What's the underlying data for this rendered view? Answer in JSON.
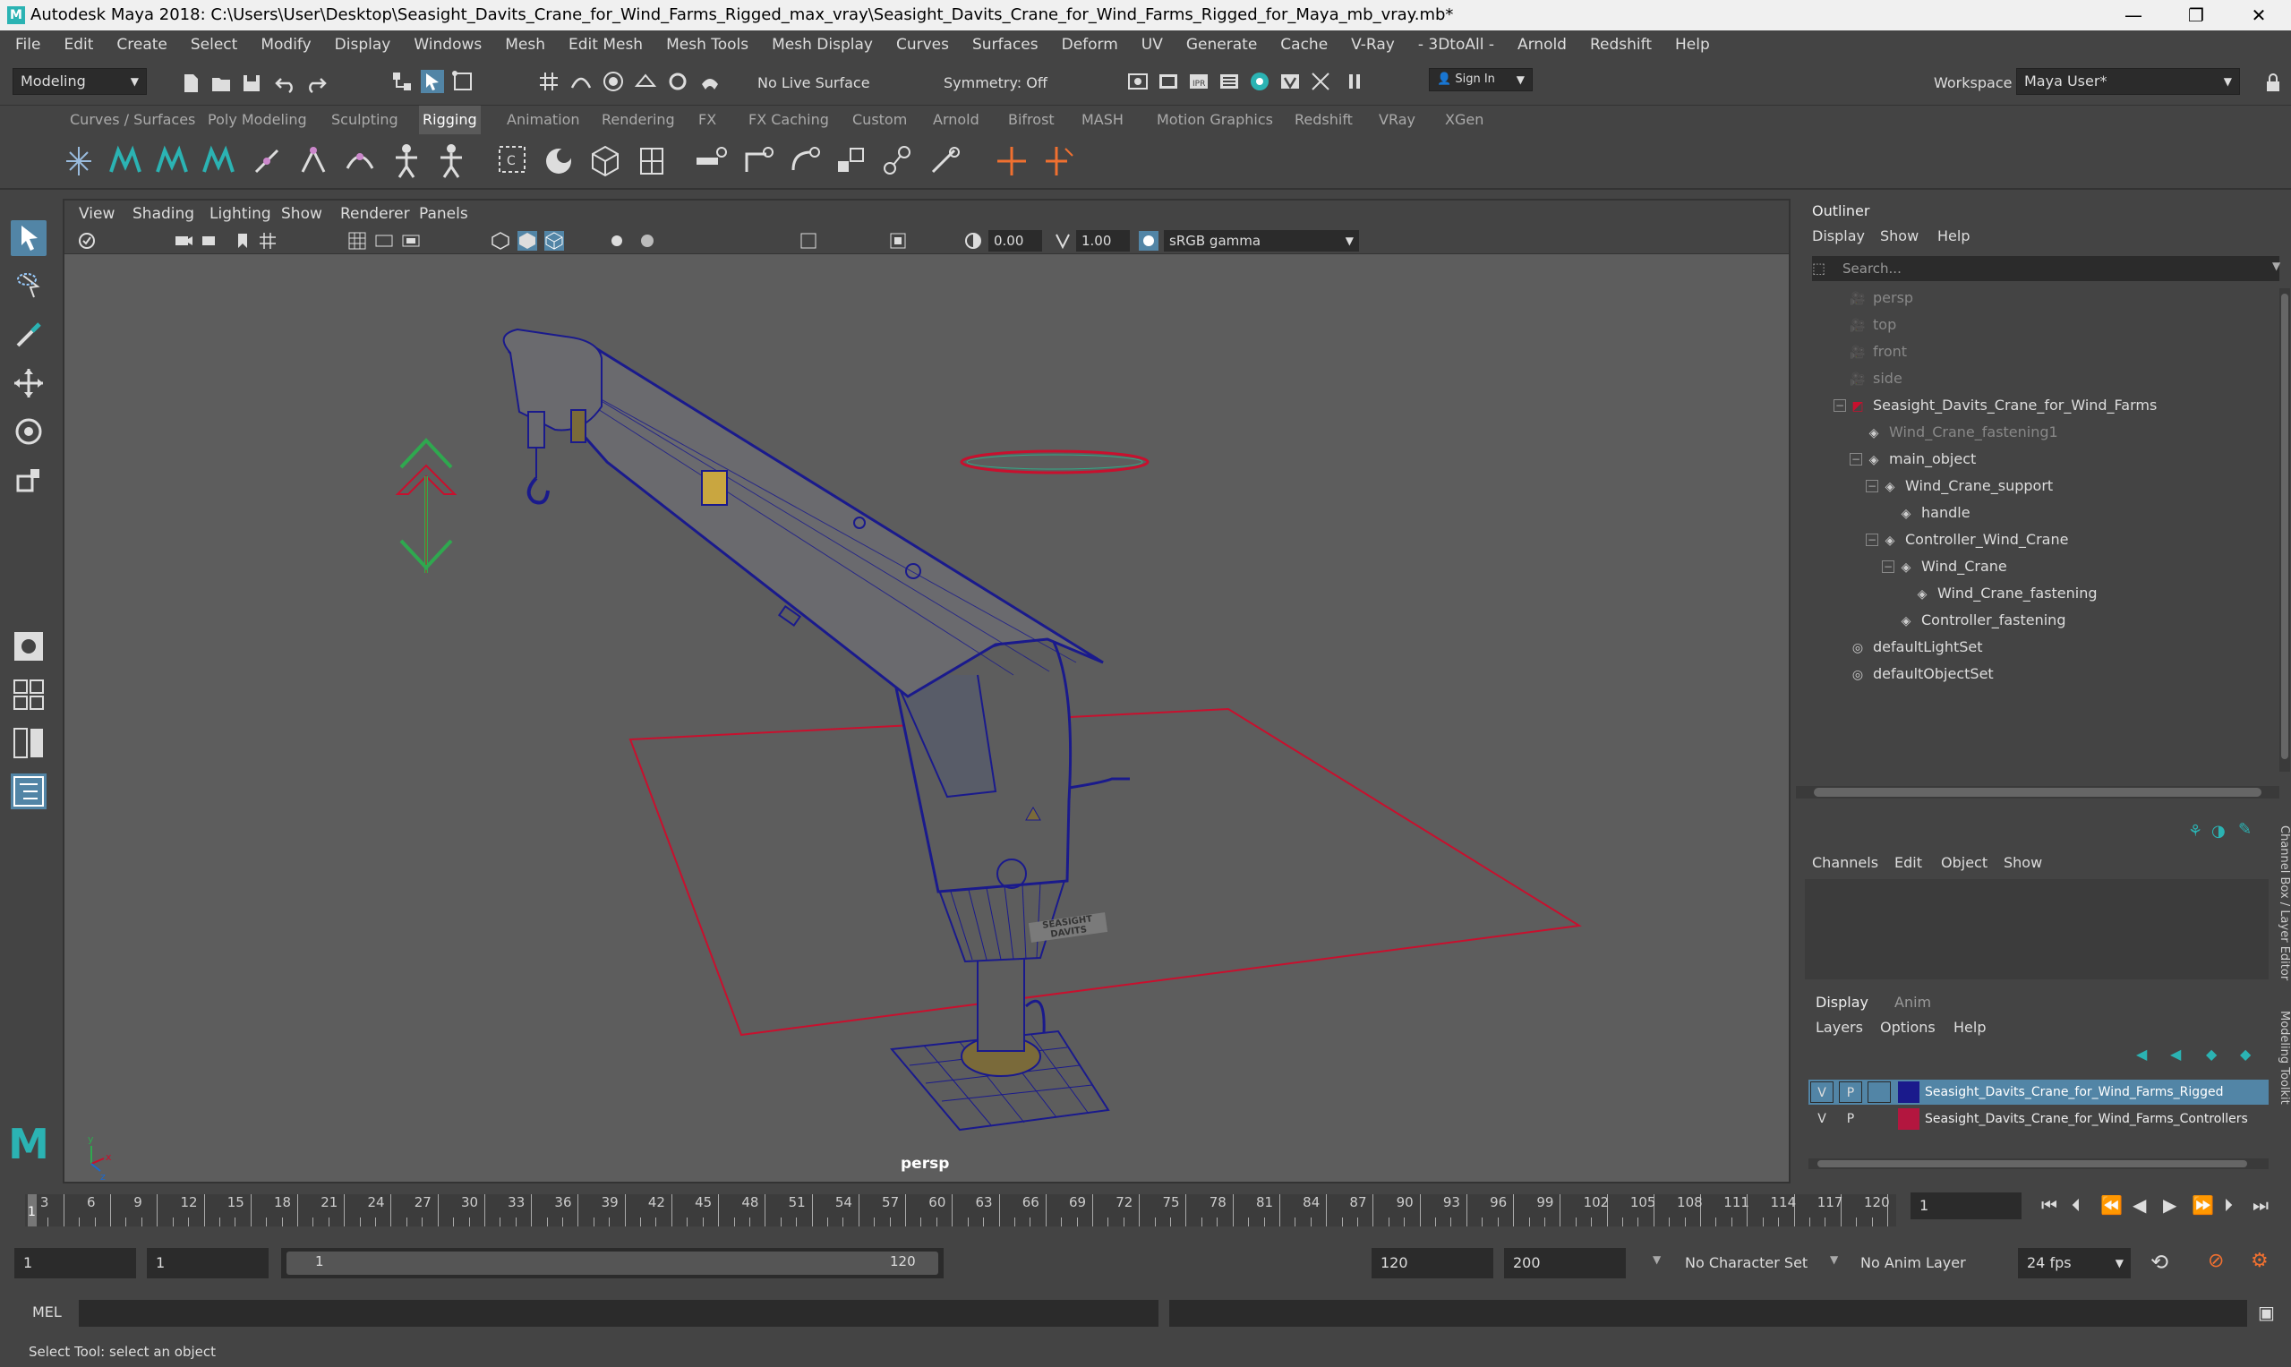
{
  "app": {
    "title": "Autodesk Maya 2018: C:\\Users\\User\\Desktop\\Seasight_Davits_Crane_for_Wind_Farms_Rigged_max_vray\\Seasight_Davits_Crane_for_Wind_Farms_Rigged_for_Maya_mb_vray.mb*",
    "logo_letter": "M"
  },
  "window_controls": {
    "minimize": "—",
    "maximize": "❐",
    "close": "✕"
  },
  "menubar": [
    "File",
    "Edit",
    "Create",
    "Select",
    "Modify",
    "Display",
    "Windows",
    "Mesh",
    "Edit Mesh",
    "Mesh Tools",
    "Mesh Display",
    "Curves",
    "Surfaces",
    "Deform",
    "UV",
    "Generate",
    "Cache",
    "V-Ray",
    "- 3DtoAll -",
    "Arnold",
    "Redshift",
    "Help"
  ],
  "status": {
    "mode": "Modeling",
    "live_surface": "No Live Surface",
    "symmetry": "Symmetry: Off",
    "sign_in": "Sign In",
    "workspace_label": "Workspace :",
    "workspace_value": "Maya User*"
  },
  "shelf_tabs": [
    "Curves / Surfaces",
    "Poly Modeling",
    "Sculpting",
    "Rigging",
    "Animation",
    "Rendering",
    "FX",
    "FX Caching",
    "Custom",
    "Arnold",
    "Bifrost",
    "MASH",
    "Motion Graphics",
    "Redshift",
    "VRay",
    "XGen"
  ],
  "shelf_active": "Rigging",
  "viewport": {
    "menu": [
      "View",
      "Shading",
      "Lighting",
      "Show",
      "Renderer",
      "Panels"
    ],
    "exposure": "0.00",
    "gamma": "1.00",
    "color_space": "sRGB gamma",
    "camera": "persp",
    "sign_text": "SEASIGHT DAVITS"
  },
  "outliner": {
    "title": "Outliner",
    "menu": [
      "Display",
      "Show",
      "Help"
    ],
    "search_placeholder": "Search...",
    "items": [
      {
        "label": "persp",
        "icon": "camera-icon",
        "dim": true
      },
      {
        "label": "top",
        "icon": "camera-icon",
        "dim": true
      },
      {
        "label": "front",
        "icon": "camera-icon",
        "dim": true
      },
      {
        "label": "side",
        "icon": "camera-icon",
        "dim": true
      },
      {
        "label": "Seasight_Davits_Crane_for_Wind_Farms",
        "icon": "group-icon",
        "dim": false
      },
      {
        "label": "Wind_Crane_fastening1",
        "icon": "transform-icon",
        "dim": true
      },
      {
        "label": "main_object",
        "icon": "transform-icon",
        "dim": false
      },
      {
        "label": "Wind_Crane_support",
        "icon": "transform-icon",
        "dim": false
      },
      {
        "label": "handle",
        "icon": "transform-icon",
        "dim": false
      },
      {
        "label": "Controller_Wind_Crane",
        "icon": "transform-icon",
        "dim": false
      },
      {
        "label": "Wind_Crane",
        "icon": "transform-icon",
        "dim": false
      },
      {
        "label": "Wind_Crane_fastening",
        "icon": "transform-icon",
        "dim": false
      },
      {
        "label": "Controller_fastening",
        "icon": "transform-icon",
        "dim": false
      },
      {
        "label": "defaultLightSet",
        "icon": "set-icon",
        "dim": false
      },
      {
        "label": "defaultObjectSet",
        "icon": "set-icon",
        "dim": false
      }
    ]
  },
  "channelbox": {
    "menu": [
      "Channels",
      "Edit",
      "Object",
      "Show"
    ],
    "tabs": [
      "Display",
      "Anim"
    ],
    "layer_menu": [
      "Layers",
      "Options",
      "Help"
    ],
    "side_label_1": "Channel Box / Layer Editor",
    "side_label_2": "Modeling Toolkit",
    "layers": [
      {
        "v": "V",
        "p": "P",
        "name": "Seasight_Davits_Crane_for_Wind_Farms_Rigged",
        "color": "#1a1a8c",
        "selected": true
      },
      {
        "v": "V",
        "p": "P",
        "name": "Seasight_Davits_Crane_for_Wind_Farms_Controllers",
        "color": "#b3163f",
        "selected": false
      }
    ]
  },
  "timeline": {
    "ticks": [
      "3",
      "6",
      "9",
      "12",
      "15",
      "18",
      "21",
      "24",
      "27",
      "30",
      "33",
      "36",
      "39",
      "42",
      "45",
      "48",
      "51",
      "54",
      "57",
      "60",
      "63",
      "66",
      "69",
      "72",
      "75",
      "78",
      "81",
      "84",
      "87",
      "90",
      "93",
      "96",
      "99",
      "102",
      "105",
      "108",
      "111",
      "114",
      "117",
      "120"
    ],
    "current_frame": "1",
    "playhead_label": "1"
  },
  "range": {
    "start": "1",
    "playback_start": "1",
    "slider_start": "1",
    "slider_end": "120",
    "playback_end": "120",
    "end": "200",
    "character_set": "No Character Set",
    "anim_layer": "No Anim Layer",
    "fps": "24 fps"
  },
  "cmd": {
    "label": "MEL"
  },
  "help_line": "Select Tool: select an object",
  "colors": {
    "accent": "#5285a6",
    "wire": "#1a1a8c",
    "ctrl_red": "#c8102e",
    "ctrl_green": "#2fa84f"
  }
}
